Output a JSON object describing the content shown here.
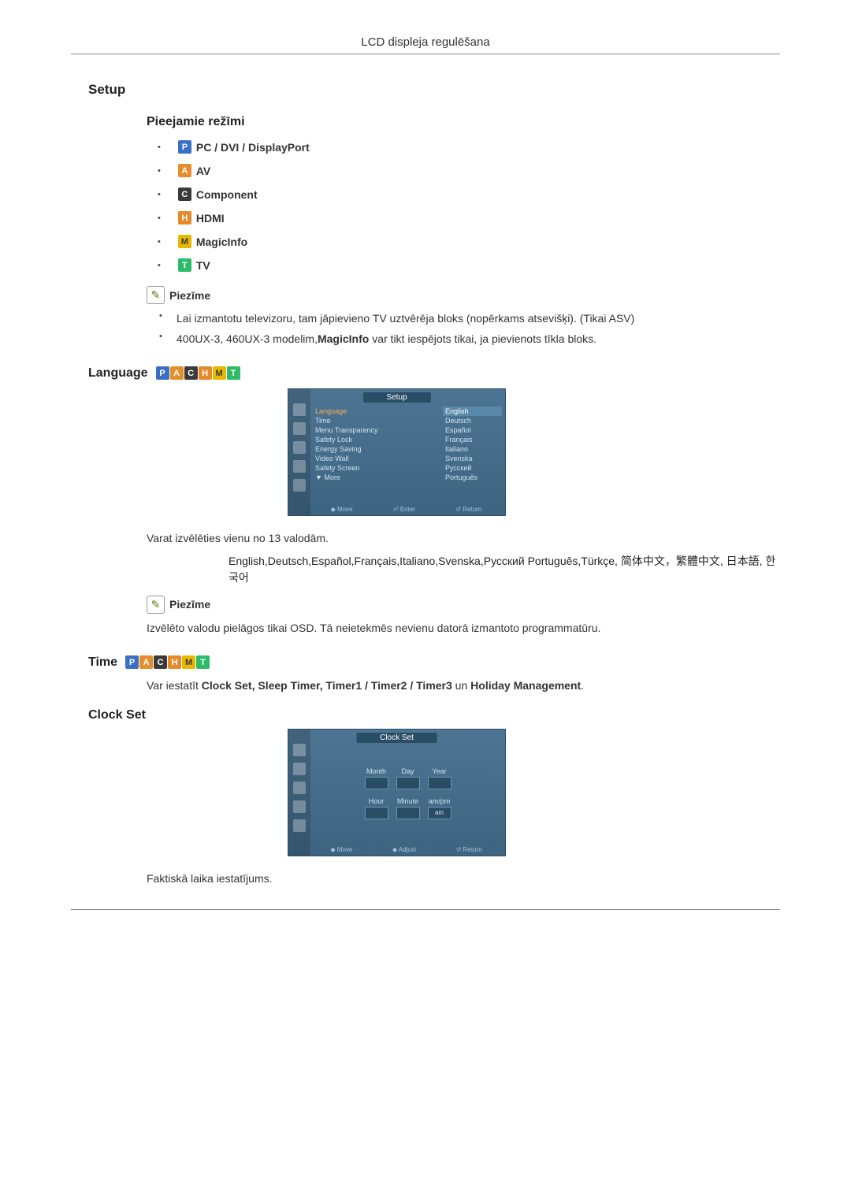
{
  "header": "LCD displeja regulēšana",
  "setup": {
    "title": "Setup",
    "modes_heading": "Pieejamie režīmi",
    "modes": [
      {
        "icon": "P",
        "label": "PC / DVI / DisplayPort"
      },
      {
        "icon": "A",
        "label": "AV"
      },
      {
        "icon": "C",
        "label": "Component"
      },
      {
        "icon": "H",
        "label": "HDMI"
      },
      {
        "icon": "M",
        "label": "MagicInfo"
      },
      {
        "icon": "T",
        "label": "TV"
      }
    ],
    "note_label": "Piezīme",
    "notes": [
      "Lai izmantotu televizoru, tam jāpievieno TV uztvērēja bloks (nopērkams atsevišķi). (Tikai ASV)",
      "400UX-3, 460UX-3 modelim,MagicInfo var tikt iespējots tikai, ja pievienots tīkla bloks."
    ]
  },
  "language": {
    "title": "Language",
    "osd": {
      "title": "Setup",
      "menu_items": [
        "Language",
        "Time",
        "Menu Transparency",
        "Safety Lock",
        "Energy Saving",
        "Video Wall",
        "Safety Screen",
        "▼ More"
      ],
      "options": [
        "English",
        "Deutsch",
        "Español",
        "Français",
        "Italiano",
        "Svenska",
        "Русский",
        "Português"
      ],
      "footer": [
        "◆ Move",
        "⏎ Enter",
        "↺ Return"
      ]
    },
    "body": "Varat izvēlēties vienu no 13 valodām.",
    "languages_list": "English,Deutsch,Español,Français,Italiano,Svenska,Русский Português,Türkçe, 简体中文，繁體中文, 日本語, 한국어",
    "note_label": "Piezīme",
    "note_body": "Izvēlēto valodu pielāgos tikai OSD. Tā neietekmēs nevienu datorā izmantoto programmatūru."
  },
  "time": {
    "title": "Time",
    "body_prefix": "Var iestatīt ",
    "body_items": "Clock Set, Sleep Timer, Timer1 / Timer2 / Timer3",
    "body_mid": " un ",
    "body_last": "Holiday Management",
    "body_suffix": "."
  },
  "clockset": {
    "title": "Clock Set",
    "osd": {
      "title": "Clock Set",
      "row1": [
        "Month",
        "Day",
        "Year"
      ],
      "row2": [
        "Hour",
        "Minute",
        "am/pm"
      ],
      "ampm": "am",
      "footer": [
        "◆ Move",
        "◆ Adjust",
        "↺ Return"
      ]
    },
    "body": "Faktiskā laika iestatījums."
  }
}
